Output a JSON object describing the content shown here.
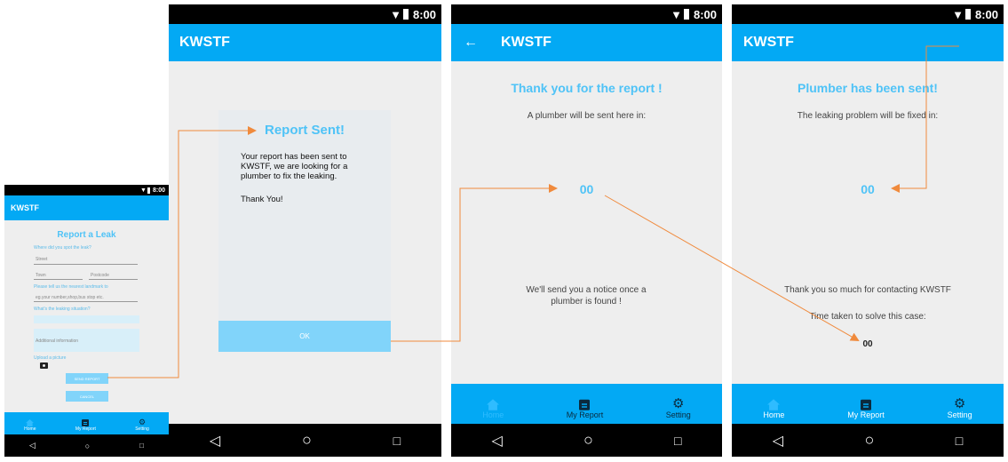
{
  "colors": {
    "accent": "#03a9f4",
    "title_blue": "#4fc3f7",
    "arrow": "#f08a3c",
    "panel": "#e8ecef",
    "ok_button": "#81d4fa"
  },
  "status": {
    "time": "8:00"
  },
  "app_name": "KWSTF",
  "screen1": {
    "title": "Report a Leak",
    "where_label": "Where did you spot the leak?",
    "street_placeholder": "Street",
    "town_placeholder": "Town",
    "postcode_placeholder": "Postcode",
    "landmark_label": "Please tell us the nearest landmark to",
    "landmark_placeholder": "eg.your number,shop,bus stop etc.",
    "situation_label": "What's the leaking situation?",
    "additional_placeholder": "Additional information",
    "upload_label": "Upload a picture",
    "camera_icon": "camera-icon",
    "send_label": "SEND REPORT",
    "cancel_label": "CANCEL",
    "nav": [
      {
        "label": "Home",
        "icon": "home-icon"
      },
      {
        "label": "My Report",
        "icon": "clipboard-icon"
      },
      {
        "label": "Setting",
        "icon": "gear-icon"
      }
    ]
  },
  "screen2": {
    "dialog_title": "Report Sent!",
    "dialog_body": "Your report has been sent to KWSTF, we are looking for a plumber to fix the leaking.",
    "dialog_thanks": "Thank You!",
    "ok_label": "OK"
  },
  "screen3": {
    "title": "Thank you for the report !",
    "subtitle": "A plumber will be sent here in:",
    "counter": "00",
    "notice": "We'll send you a notice once a plumber is found !",
    "nav": [
      {
        "label": "Home",
        "icon": "home-icon"
      },
      {
        "label": "My Report",
        "icon": "clipboard-icon"
      },
      {
        "label": "Setting",
        "icon": "gear-icon"
      }
    ]
  },
  "screen4": {
    "title": "Plumber has been sent!",
    "subtitle": "The leaking problem will be fixed in:",
    "counter": "00",
    "thanks": "Thank you so much for contacting KWSTF",
    "time_label": "Time taken to solve this case:",
    "time_value": "00",
    "nav": [
      {
        "label": "Home",
        "icon": "home-icon"
      },
      {
        "label": "My Report",
        "icon": "clipboard-icon"
      },
      {
        "label": "Setting",
        "icon": "gear-icon"
      }
    ]
  }
}
